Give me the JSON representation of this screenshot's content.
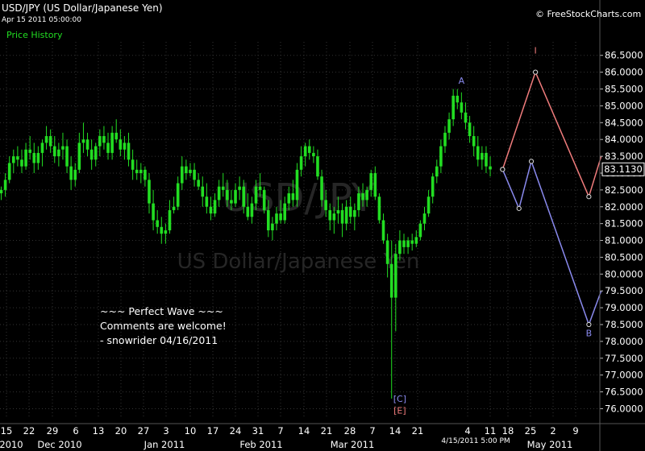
{
  "header": {
    "symbol_title": "USD/JPY (US Dollar/Japanese Yen)",
    "timestamp": "Apr 15 2011 05:00:00",
    "panel_label": "Price History",
    "copyright": "© FreeStockCharts.com"
  },
  "watermark": {
    "symbol": "USD/JPY",
    "name": "US Dollar/Japanese Yen"
  },
  "annotation": {
    "line1": "~~~ Perfect Wave ~~~",
    "line2": "Comments are welcome!",
    "line3": "- snowrider  04/16/2011"
  },
  "colors": {
    "background": "#000000",
    "candles": "#22dd22",
    "wave_up": "#f07c7c",
    "wave_down": "#8a8aee",
    "grid": "#333333",
    "axis_text": "#ffffff"
  },
  "chart_data": {
    "type": "candlestick",
    "title": "USD/JPY (US Dollar/Japanese Yen)",
    "ylim": [
      75.7,
      86.9
    ],
    "y_ticks": [
      76.0,
      76.5,
      77.0,
      77.5,
      78.0,
      78.5,
      79.0,
      79.5,
      80.0,
      80.5,
      81.0,
      81.5,
      82.0,
      82.5,
      83.0,
      83.5,
      84.0,
      84.5,
      85.0,
      85.5,
      86.0,
      86.5
    ],
    "y_tick_labels": [
      "76.0000",
      "76.5000",
      "77.0000",
      "77.5000",
      "78.0000",
      "78.5000",
      "79.0000",
      "79.5000",
      "80.0000",
      "80.5000",
      "81.0000",
      "81.5000",
      "82.0000",
      "82.5000",
      "83.0000",
      "83.5000",
      "84.0000",
      "84.5000",
      "85.0000",
      "85.5000",
      "86.0000",
      "86.5000"
    ],
    "x_tick_labels": [
      "15",
      "22",
      "29",
      "6",
      "13",
      "20",
      "27",
      "3",
      "10",
      "17",
      "24",
      "31",
      "7",
      "14",
      "21",
      "28",
      "7",
      "14",
      "21",
      "4",
      "11",
      "18",
      "25",
      "2",
      "9"
    ],
    "x_period_labels": [
      "2010",
      "Dec 2010",
      "Jan 2011",
      "Feb 2011",
      "Mar 2011",
      "May 2011"
    ],
    "cursor_time_label": "4/15/2011 5:00 PM",
    "last_price_label": "83.1130",
    "last_price": 83.113,
    "grid": true,
    "candles": [
      [
        82.4,
        82.6,
        82.2,
        82.5
      ],
      [
        82.5,
        83.0,
        82.3,
        82.8
      ],
      [
        82.8,
        83.5,
        82.7,
        83.3
      ],
      [
        83.3,
        83.7,
        83.0,
        83.5
      ],
      [
        83.5,
        83.8,
        83.2,
        83.4
      ],
      [
        83.4,
        83.7,
        83.0,
        83.2
      ],
      [
        83.2,
        83.9,
        83.1,
        83.7
      ],
      [
        83.7,
        84.1,
        83.4,
        83.6
      ],
      [
        83.6,
        83.9,
        83.0,
        83.3
      ],
      [
        83.3,
        83.8,
        83.1,
        83.6
      ],
      [
        83.6,
        84.0,
        83.2,
        83.9
      ],
      [
        83.9,
        84.4,
        83.7,
        84.1
      ],
      [
        84.1,
        84.3,
        83.6,
        83.8
      ],
      [
        83.8,
        84.1,
        83.3,
        83.5
      ],
      [
        83.5,
        83.9,
        83.2,
        83.7
      ],
      [
        83.7,
        84.2,
        83.4,
        83.8
      ],
      [
        83.8,
        84.0,
        83.0,
        83.2
      ],
      [
        83.2,
        83.5,
        82.5,
        82.8
      ],
      [
        82.8,
        83.3,
        82.6,
        83.1
      ],
      [
        83.1,
        84.2,
        83.0,
        83.9
      ],
      [
        83.9,
        84.5,
        83.6,
        84.0
      ],
      [
        84.0,
        84.2,
        83.5,
        83.7
      ],
      [
        83.7,
        84.0,
        83.1,
        83.4
      ],
      [
        83.4,
        83.9,
        83.2,
        83.8
      ],
      [
        83.8,
        84.3,
        83.5,
        84.1
      ],
      [
        84.1,
        84.4,
        83.7,
        83.9
      ],
      [
        83.9,
        84.2,
        83.4,
        83.6
      ],
      [
        83.6,
        84.4,
        83.4,
        84.2
      ],
      [
        84.2,
        84.6,
        83.9,
        84.0
      ],
      [
        84.0,
        84.3,
        83.5,
        83.7
      ],
      [
        83.7,
        84.1,
        83.4,
        83.9
      ],
      [
        83.9,
        84.2,
        83.2,
        83.4
      ],
      [
        83.4,
        83.7,
        82.8,
        83.1
      ],
      [
        83.1,
        83.4,
        82.8,
        83.0
      ],
      [
        83.0,
        83.3,
        82.7,
        83.1
      ],
      [
        83.1,
        83.2,
        82.6,
        82.8
      ],
      [
        82.8,
        83.0,
        81.8,
        82.1
      ],
      [
        82.1,
        82.5,
        81.3,
        81.6
      ],
      [
        81.6,
        81.9,
        81.2,
        81.4
      ],
      [
        81.4,
        81.7,
        80.9,
        81.2
      ],
      [
        81.2,
        81.5,
        80.9,
        81.3
      ],
      [
        81.3,
        82.2,
        81.2,
        81.9
      ],
      [
        81.9,
        82.3,
        81.8,
        82.0
      ],
      [
        82.0,
        82.9,
        81.9,
        82.7
      ],
      [
        82.7,
        83.5,
        82.5,
        83.2
      ],
      [
        83.2,
        83.4,
        82.8,
        83.0
      ],
      [
        83.0,
        83.3,
        82.9,
        83.1
      ],
      [
        83.1,
        83.3,
        82.6,
        82.8
      ],
      [
        82.8,
        83.0,
        82.5,
        82.6
      ],
      [
        82.6,
        82.9,
        82.0,
        82.3
      ],
      [
        82.3,
        82.7,
        81.8,
        82.0
      ],
      [
        82.0,
        82.3,
        81.6,
        81.8
      ],
      [
        81.8,
        82.4,
        81.7,
        82.2
      ],
      [
        82.2,
        82.8,
        82.0,
        82.6
      ],
      [
        82.6,
        83.0,
        82.3,
        82.5
      ],
      [
        82.5,
        82.8,
        82.0,
        82.2
      ],
      [
        82.2,
        82.5,
        81.9,
        82.1
      ],
      [
        82.1,
        82.7,
        82.0,
        82.5
      ],
      [
        82.5,
        82.9,
        82.2,
        82.6
      ],
      [
        82.6,
        82.8,
        81.8,
        82.0
      ],
      [
        82.0,
        82.4,
        81.6,
        81.7
      ],
      [
        81.7,
        82.3,
        81.5,
        82.1
      ],
      [
        82.1,
        82.8,
        81.9,
        82.6
      ],
      [
        82.6,
        83.0,
        82.3,
        82.5
      ],
      [
        82.5,
        82.6,
        81.8,
        81.9
      ],
      [
        81.9,
        82.2,
        81.1,
        81.3
      ],
      [
        81.3,
        81.7,
        81.0,
        81.5
      ],
      [
        81.5,
        82.0,
        81.3,
        81.8
      ],
      [
        81.8,
        82.2,
        81.5,
        81.6
      ],
      [
        81.6,
        82.3,
        81.5,
        82.1
      ],
      [
        82.1,
        82.6,
        81.9,
        82.4
      ],
      [
        82.4,
        82.8,
        82.0,
        82.2
      ],
      [
        82.2,
        83.3,
        82.0,
        83.1
      ],
      [
        83.1,
        83.8,
        82.9,
        83.5
      ],
      [
        83.5,
        83.9,
        83.2,
        83.8
      ],
      [
        83.8,
        84.0,
        83.4,
        83.6
      ],
      [
        83.6,
        83.8,
        83.3,
        83.5
      ],
      [
        83.5,
        83.7,
        82.8,
        82.9
      ],
      [
        82.9,
        83.1,
        82.0,
        82.2
      ],
      [
        82.2,
        82.5,
        81.7,
        81.9
      ],
      [
        81.9,
        82.1,
        81.3,
        81.6
      ],
      [
        81.6,
        82.0,
        81.2,
        81.8
      ],
      [
        81.8,
        82.3,
        81.5,
        81.9
      ],
      [
        81.9,
        82.1,
        81.1,
        81.5
      ],
      [
        81.5,
        82.2,
        81.3,
        82.0
      ],
      [
        82.0,
        82.3,
        81.5,
        81.7
      ],
      [
        81.7,
        82.1,
        81.3,
        81.9
      ],
      [
        81.9,
        82.6,
        81.7,
        82.4
      ],
      [
        82.4,
        82.7,
        82.0,
        82.2
      ],
      [
        82.2,
        82.6,
        82.0,
        82.5
      ],
      [
        82.5,
        83.1,
        82.3,
        83.0
      ],
      [
        83.0,
        83.2,
        82.2,
        82.3
      ],
      [
        82.3,
        82.4,
        81.5,
        81.6
      ],
      [
        81.6,
        81.8,
        80.9,
        81.0
      ],
      [
        81.0,
        81.2,
        79.9,
        80.3
      ],
      [
        80.3,
        81.0,
        76.3,
        79.3
      ],
      [
        79.3,
        80.9,
        78.3,
        80.6
      ],
      [
        80.6,
        81.3,
        80.4,
        81.0
      ],
      [
        81.0,
        81.2,
        80.6,
        80.8
      ],
      [
        80.8,
        81.1,
        80.6,
        81.0
      ],
      [
        81.0,
        81.2,
        80.7,
        80.9
      ],
      [
        80.9,
        81.3,
        80.8,
        81.1
      ],
      [
        81.1,
        81.6,
        81.0,
        81.5
      ],
      [
        81.5,
        82.0,
        81.3,
        81.8
      ],
      [
        81.8,
        82.5,
        81.7,
        82.3
      ],
      [
        82.3,
        83.0,
        82.1,
        82.9
      ],
      [
        82.9,
        83.4,
        82.7,
        83.2
      ],
      [
        83.2,
        84.0,
        83.0,
        83.8
      ],
      [
        83.8,
        84.4,
        83.6,
        84.2
      ],
      [
        84.2,
        84.8,
        84.0,
        84.6
      ],
      [
        84.6,
        85.5,
        84.4,
        85.3
      ],
      [
        85.3,
        85.5,
        84.9,
        85.1
      ],
      [
        85.1,
        85.4,
        84.6,
        84.8
      ],
      [
        84.8,
        85.1,
        84.3,
        84.5
      ],
      [
        84.5,
        84.7,
        83.9,
        84.1
      ],
      [
        84.1,
        84.4,
        83.5,
        83.8
      ],
      [
        83.8,
        84.1,
        83.2,
        83.4
      ],
      [
        83.4,
        83.8,
        83.1,
        83.6
      ],
      [
        83.6,
        83.8,
        83.0,
        83.2
      ],
      [
        83.2,
        83.5,
        82.9,
        83.11
      ]
    ],
    "wave_labels": [
      {
        "text": "A",
        "x_index": 112,
        "y": 85.65,
        "color": "#8a8aee"
      },
      {
        "text": "I",
        "x_index": 130,
        "y": 86.55,
        "color": "#f07c7c"
      },
      {
        "text": "B",
        "x_index": 143,
        "y": 78.15,
        "color": "#8a8aee"
      },
      {
        "text": "[C]",
        "x_index": 97,
        "y": 76.2,
        "color": "#8a8aee"
      },
      {
        "text": "[E]",
        "x_index": 97,
        "y": 75.85,
        "color": "#f07c7c"
      }
    ],
    "projection_up": [
      [
        122,
        83.11
      ],
      [
        130,
        86.0
      ],
      [
        143,
        82.3
      ],
      [
        146,
        83.5
      ]
    ],
    "projection_down": [
      [
        122,
        83.11
      ],
      [
        126,
        81.95
      ],
      [
        129,
        83.35
      ],
      [
        143,
        78.5
      ],
      [
        146,
        79.5
      ]
    ]
  }
}
